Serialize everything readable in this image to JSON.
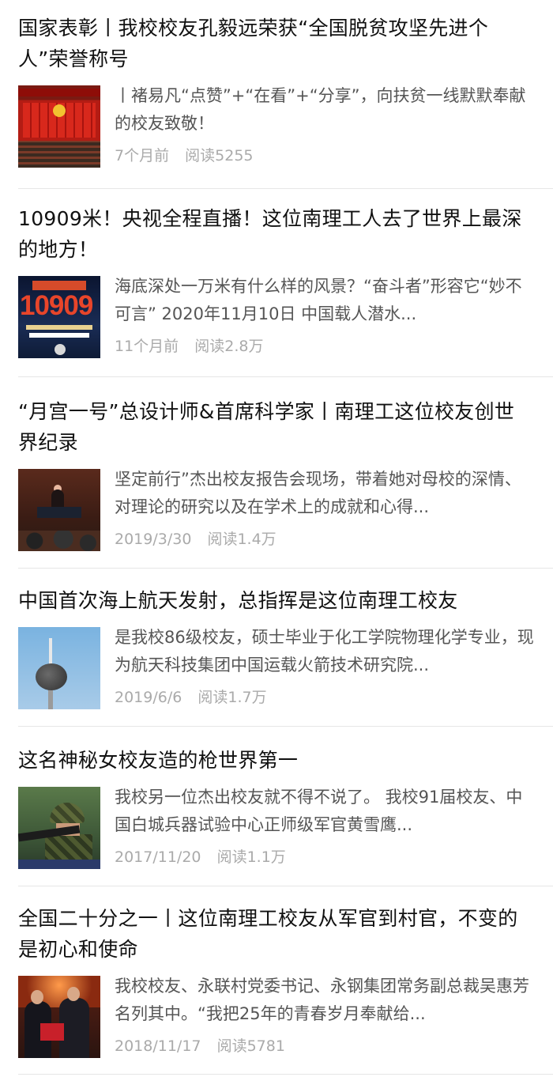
{
  "articles": [
    {
      "title": "国家表彰丨我校校友孔毅远荣获“全国脱贫攻坚先进个人”荣誉称号",
      "summary": "丨褚易凡“点赞”+“在看”+“分享”，向扶贫一线默默奉献的校友致敬！",
      "date": "7个月前",
      "reads": "阅读5255",
      "thumb": "ceremony-photo"
    },
    {
      "title": "10909米！央视全程直播！这位南理工人去了世界上最深的地方！",
      "summary": "海底深处一万米有什么样的风景？“奋斗者”形容它“妙不可言” 2020年11月10日 中国载人潜水...",
      "date": "11个月前",
      "reads": "阅读2.8万",
      "thumb": "deep-sea-poster",
      "thumb_text": "10909"
    },
    {
      "title": "“月宫一号”总设计师&首席科学家丨南理工这位校友创世界纪录",
      "summary": "坚定前行”杰出校友报告会现场，带着她对母校的深情、对理论的研究以及在学术上的成就和心得...",
      "date": "2019/3/30",
      "reads": "阅读1.4万",
      "thumb": "lecture-photo"
    },
    {
      "title": "中国首次海上航天发射，总指挥是这位南理工校友",
      "summary": "是我校86级校友，硕士毕业于化工学院物理化学专业，现为航天科技集团中国运载火箭技术研究院...",
      "date": "2019/6/6",
      "reads": "阅读1.7万",
      "thumb": "rocket-launch-photo"
    },
    {
      "title": "这名神秘女校友造的枪世界第一",
      "summary": "我校另一位杰出校友就不得不说了。 我校91届校友、中国白城兵器试验中心正师级军官黄雪鹰...",
      "date": "2017/11/20",
      "reads": "阅读1.1万",
      "thumb": "soldier-photo"
    },
    {
      "title": "全国二十分之一丨这位南理工校友从军官到村官，不变的是初心和使命",
      "summary": "我校校友、永联村党委书记、永钢集团常务副总裁吴惠芳名列其中。“我把25年的青春岁月奉献给...",
      "date": "2018/11/17",
      "reads": "阅读5781",
      "thumb": "award-photo"
    }
  ]
}
